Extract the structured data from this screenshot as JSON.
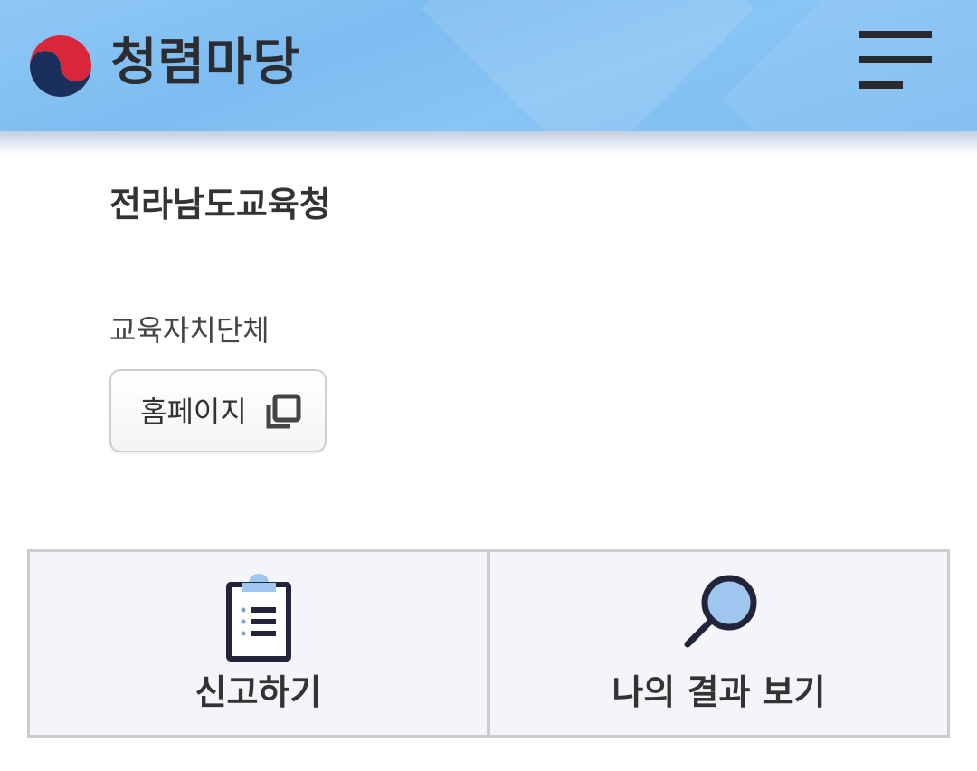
{
  "header": {
    "title": "청렴마당",
    "logo_icon": "taegeuk-logo-icon",
    "menu_icon": "hamburger-menu-icon",
    "colors": {
      "background": "#7dbcf1",
      "logo_red": "#d9263a",
      "logo_navy": "#1b2f5c"
    }
  },
  "organization": {
    "name": "전라남도교육청"
  },
  "autonomy": {
    "label": "교육자치단체",
    "homepage_button": {
      "label": "홈페이지",
      "icon": "external-window-icon"
    }
  },
  "actions": [
    {
      "label": "신고하기",
      "icon": "clipboard-icon"
    },
    {
      "label": "나의 결과 보기",
      "icon": "magnifier-icon"
    }
  ]
}
